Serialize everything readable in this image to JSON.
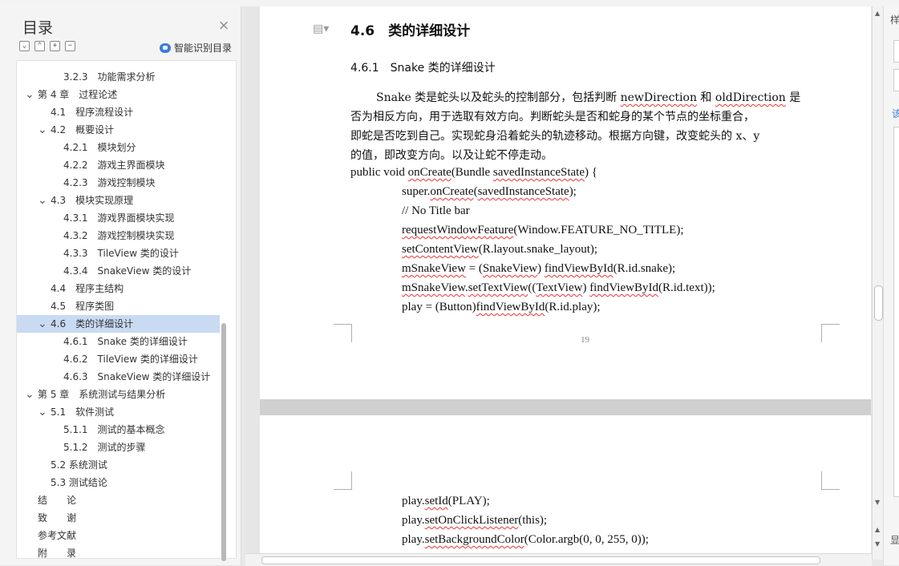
{
  "nav": {
    "title": "目录",
    "close": "×",
    "tools": [
      "⌄",
      "⌃",
      "+",
      "−"
    ],
    "smart_label": "智能识别目录",
    "items": [
      {
        "label": "3.2.3　功能需求分析",
        "level": 3,
        "chevron": ""
      },
      {
        "label": "第 4 章　过程论述",
        "level": 1,
        "chevron": "v"
      },
      {
        "label": "4.1　程序流程设计",
        "level": 2,
        "chevron": ""
      },
      {
        "label": "4.2　概要设计",
        "level": 2,
        "chevron": "v"
      },
      {
        "label": "4.2.1　模块划分",
        "level": 3,
        "chevron": ""
      },
      {
        "label": "4.2.2　游戏主界面模块",
        "level": 3,
        "chevron": ""
      },
      {
        "label": "4.2.3　游戏控制模块",
        "level": 3,
        "chevron": ""
      },
      {
        "label": "4.3　模块实现原理",
        "level": 2,
        "chevron": "v"
      },
      {
        "label": "4.3.1　游戏界面模块实现",
        "level": 3,
        "chevron": ""
      },
      {
        "label": "4.3.2　游戏控制模块实现",
        "level": 3,
        "chevron": ""
      },
      {
        "label": "4.3.3　TileView 类的设计",
        "level": 3,
        "chevron": ""
      },
      {
        "label": "4.3.4　SnakeView 类的设计",
        "level": 3,
        "chevron": ""
      },
      {
        "label": "4.4　程序主结构",
        "level": 2,
        "chevron": ""
      },
      {
        "label": "4.5　程序类图",
        "level": 2,
        "chevron": ""
      },
      {
        "label": "4.6　类的详细设计",
        "level": 2,
        "chevron": "v",
        "selected": true
      },
      {
        "label": "4.6.1　Snake 类的详细设计",
        "level": 3,
        "chevron": ""
      },
      {
        "label": "4.6.2　TileView 类的详细设计",
        "level": 3,
        "chevron": ""
      },
      {
        "label": "4.6.3　SnakeView 类的详细设计",
        "level": 3,
        "chevron": ""
      },
      {
        "label": "第 5 章　系统测试与结果分析",
        "level": 1,
        "chevron": "v"
      },
      {
        "label": "5.1　软件测试",
        "level": 2,
        "chevron": "v"
      },
      {
        "label": "5.1.1　测试的基本概念",
        "level": 3,
        "chevron": ""
      },
      {
        "label": "5.1.2　测试的步骤",
        "level": 3,
        "chevron": ""
      },
      {
        "label": "5.2 系统测试",
        "level": 2,
        "chevron": ""
      },
      {
        "label": "5.3 测试结论",
        "level": 2,
        "chevron": ""
      },
      {
        "label": "结　　论",
        "level": 1,
        "chevron": ""
      },
      {
        "label": "致　　谢",
        "level": 1,
        "chevron": ""
      },
      {
        "label": "参考文献",
        "level": 1,
        "chevron": ""
      },
      {
        "label": "附　　录",
        "level": 1,
        "chevron": ""
      }
    ]
  },
  "doc": {
    "heading": "4.6　类的详细设计",
    "subheading": "4.6.1　Snake 类的详细设计",
    "para": [
      "Snake 类是蛇头以及蛇头的控制部分，包括判断 newDirection 和 oldDirection 是",
      "否为相反方向，用于选取有效方向。判断蛇头是否和蛇身的某个节点的坐标重合，",
      "即蛇是否吃到自己。实现蛇身沿着蛇头的轨迹移动。根据方向键，改变蛇头的 x、y",
      "的值，即改变方向。以及让蛇不停走动。"
    ],
    "code_page1": [
      "public void onCreate(Bundle savedInstanceState) {",
      "super.onCreate(savedInstanceState);",
      "// No Title bar",
      "requestWindowFeature(Window.FEATURE_NO_TITLE);",
      "setContentView(R.layout.snake_layout);",
      "mSnakeView = (SnakeView) findViewById(R.id.snake);",
      "mSnakeView.setTextView((TextView) findViewById(R.id.text));",
      "play = (Button)findViewById(R.id.play);"
    ],
    "page_number": "19",
    "code_page2": [
      "play.setId(PLAY);",
      "play.setOnClickListener(this);",
      "play.setBackgroundColor(Color.argb(0, 0, 255, 0));"
    ]
  },
  "rpanel": {
    "top_text": "样",
    "blue_text": "该",
    "bottom_text": "显"
  },
  "colors": {
    "selected_bg": "#c9daf3",
    "accent": "#3b7be0",
    "squiggle": "#e33333"
  }
}
